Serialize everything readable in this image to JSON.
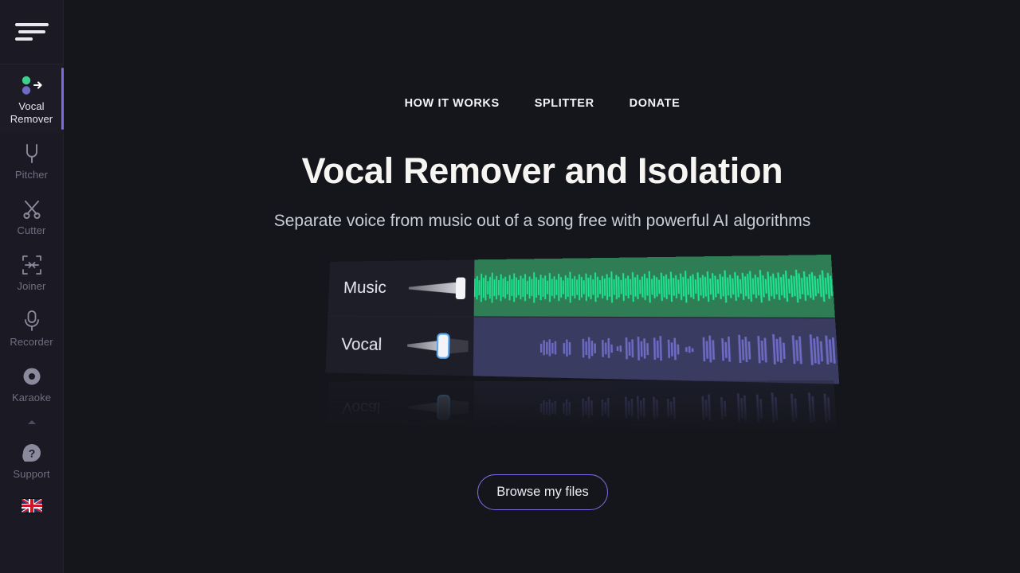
{
  "app": {
    "background": "#15161c",
    "sidebar_background": "#1b1a24",
    "accent": "#7b6ce0"
  },
  "sidebar": {
    "menu_button": {
      "name": "menu",
      "label": "Menu"
    },
    "items": [
      {
        "label_line1": "Vocal",
        "label_line2": "Remover",
        "icon": "vocal-remover-icon",
        "active": true
      },
      {
        "label_line1": "Pitcher",
        "label_line2": "",
        "icon": "tuning-fork-icon",
        "active": false
      },
      {
        "label_line1": "Cutter",
        "label_line2": "",
        "icon": "scissors-icon",
        "active": false
      },
      {
        "label_line1": "Joiner",
        "label_line2": "",
        "icon": "join-arrows-icon",
        "active": false
      },
      {
        "label_line1": "Recorder",
        "label_line2": "",
        "icon": "microphone-icon",
        "active": false
      },
      {
        "label_line1": "Karaoke",
        "label_line2": "",
        "icon": "record-disc-icon",
        "active": false
      }
    ],
    "collapse": {
      "icon": "chevron-up-icon"
    },
    "support": {
      "label": "Support",
      "icon": "question-mark-icon"
    },
    "language": {
      "icon": "uk-flag-icon",
      "label": "English"
    }
  },
  "topnav": {
    "links": [
      {
        "label": "HOW IT WORKS"
      },
      {
        "label": "SPLITTER"
      },
      {
        "label": "DONATE"
      }
    ]
  },
  "hero": {
    "title": "Vocal Remover and Isolation",
    "subtitle": "Separate voice from music out of a song free with powerful AI algorithms",
    "cta_label": "Browse my files"
  },
  "illustration": {
    "name": "mixer-preview",
    "tracks": [
      {
        "label": "Music",
        "wave_color": "#1ee792",
        "panel_color": "#2f7d55",
        "fader_position": "max"
      },
      {
        "label": "Vocal",
        "wave_color": "#6d6bc4",
        "panel_color": "#3a3b60",
        "fader_position": "mid"
      }
    ],
    "reflection_label": "Vocal"
  }
}
